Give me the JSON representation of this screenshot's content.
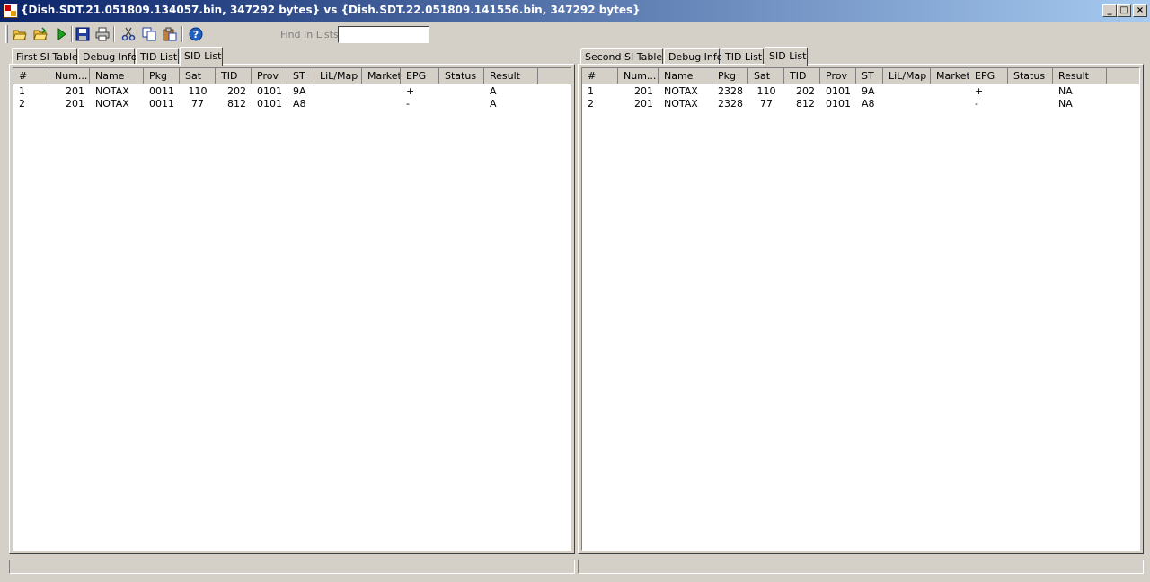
{
  "window": {
    "title": "{Dish.SDT.21.051809.134057.bin, 347292 bytes} vs {Dish.SDT.22.051809.141556.bin, 347292 bytes}",
    "minimize": "_",
    "maximize": "□",
    "close": "×"
  },
  "toolbar": {
    "icons": [
      "open-folder-icon",
      "open-folder-icon",
      "run-icon",
      "save-icon",
      "print-icon",
      "cut-icon",
      "copy-icon",
      "paste-icon",
      "help-icon"
    ],
    "find_label": "Find In Lists:",
    "find_value": ""
  },
  "left": {
    "tabs": [
      "First SI Table",
      "Debug Info",
      "TID List",
      "SID List"
    ],
    "active_tab": "SID List",
    "columns": [
      "#",
      "Num...",
      "Name",
      "Pkg",
      "Sat",
      "TID",
      "Prov",
      "ST",
      "LiL/Map",
      "Market",
      "EPG",
      "Status",
      "Result"
    ],
    "rows": [
      [
        "1",
        "201",
        "NOTAX",
        "0011",
        "110",
        "202",
        "0101",
        "9A",
        "",
        "",
        "+",
        "",
        "A"
      ],
      [
        "2",
        "201",
        "NOTAX",
        "0011",
        "77",
        "812",
        "0101",
        "A8",
        "",
        "",
        "-",
        "",
        "A"
      ]
    ]
  },
  "right": {
    "tabs": [
      "Second SI Table",
      "Debug Info",
      "TID List",
      "SID List"
    ],
    "active_tab": "SID List",
    "columns": [
      "#",
      "Num...",
      "Name",
      "Pkg",
      "Sat",
      "TID",
      "Prov",
      "ST",
      "LiL/Map",
      "Market",
      "EPG",
      "Status",
      "Result"
    ],
    "rows": [
      [
        "1",
        "201",
        "NOTAX",
        "2328",
        "110",
        "202",
        "0101",
        "9A",
        "",
        "",
        "+",
        "",
        "NA"
      ],
      [
        "2",
        "201",
        "NOTAX",
        "2328",
        "77",
        "812",
        "0101",
        "A8",
        "",
        "",
        "-",
        "",
        "NA"
      ]
    ]
  },
  "colors": {
    "title_start": "#0a246a",
    "title_end": "#a6caf0",
    "face": "#d4d0c8"
  }
}
